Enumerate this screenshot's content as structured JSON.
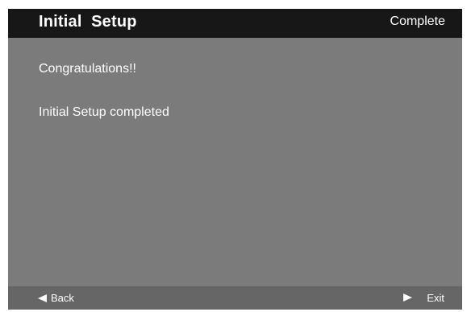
{
  "header": {
    "title": "Initial  Setup",
    "status": "Complete"
  },
  "content": {
    "congrats": "Congratulations!!",
    "message": "Initial Setup completed"
  },
  "footer": {
    "back_label": "Back",
    "back_icon": "triangle-left-icon",
    "exit_label": "Exit",
    "exit_icon": "triangle-right-icon"
  },
  "colors": {
    "header_bg": "#171717",
    "panel_bg": "#7b7b7b",
    "footer_bg": "#666666",
    "text": "#ffffff"
  }
}
